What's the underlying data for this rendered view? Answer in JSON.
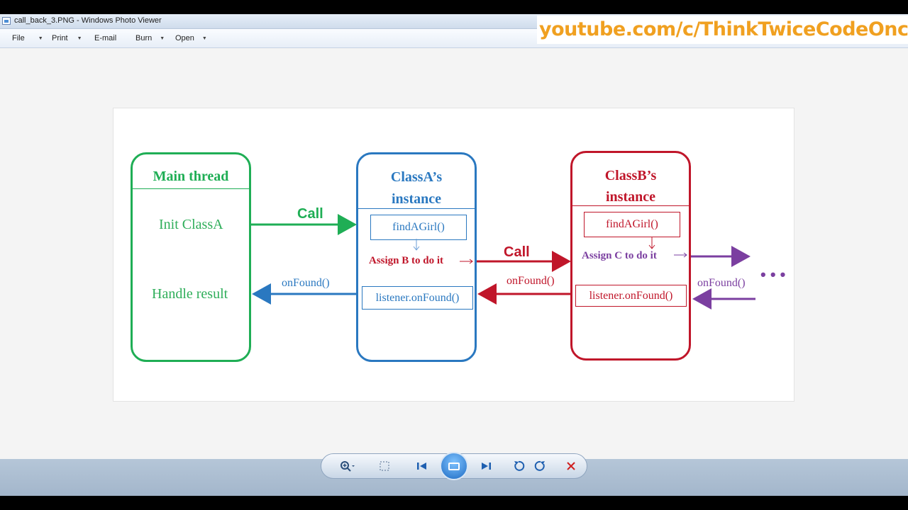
{
  "window": {
    "title": "call_back_3.PNG - Windows Photo Viewer"
  },
  "menu": {
    "items": [
      {
        "label": "File",
        "has_dropdown": true
      },
      {
        "label": "Print",
        "has_dropdown": true
      },
      {
        "label": "E-mail",
        "has_dropdown": false
      },
      {
        "label": "Burn",
        "has_dropdown": true
      },
      {
        "label": "Open",
        "has_dropdown": true
      }
    ]
  },
  "watermark": {
    "text": "youtube.com/c/ThinkTwiceCodeOnce",
    "color": "#f0a020"
  },
  "diagram": {
    "main": {
      "title": "Main thread",
      "init_label": "Init ClassA",
      "handle_label": "Handle result",
      "color": "#1fae55"
    },
    "classA": {
      "title_line1": "ClassA’s",
      "title_line2": "instance",
      "method": "findAGirl()",
      "assign": "Assign B to do it",
      "listener": "listener.onFound()",
      "color": "#2a78c0"
    },
    "classB": {
      "title_line1": "ClassB’s",
      "title_line2": "instance",
      "method": "findAGirl()",
      "assign": "Assign C to do it",
      "listener": "listener.onFound()",
      "color": "#c0162a"
    },
    "arrows": {
      "call_green": "Call",
      "onfound_blue": "onFound()",
      "call_red": "Call",
      "onfound_red": "onFound()",
      "onfound_purple": "onFound()",
      "ellipsis": "• • •"
    },
    "purple_color": "#7b3fa0"
  },
  "toolbar": {
    "zoom_icon": "zoom-icon",
    "fit_icon": "actual-size-icon",
    "prev_icon": "previous-icon",
    "slideshow_icon": "slideshow-icon",
    "next_icon": "next-icon",
    "rotate_ccw_icon": "rotate-counterclockwise-icon",
    "rotate_cw_icon": "rotate-clockwise-icon",
    "delete_icon": "delete-icon"
  }
}
